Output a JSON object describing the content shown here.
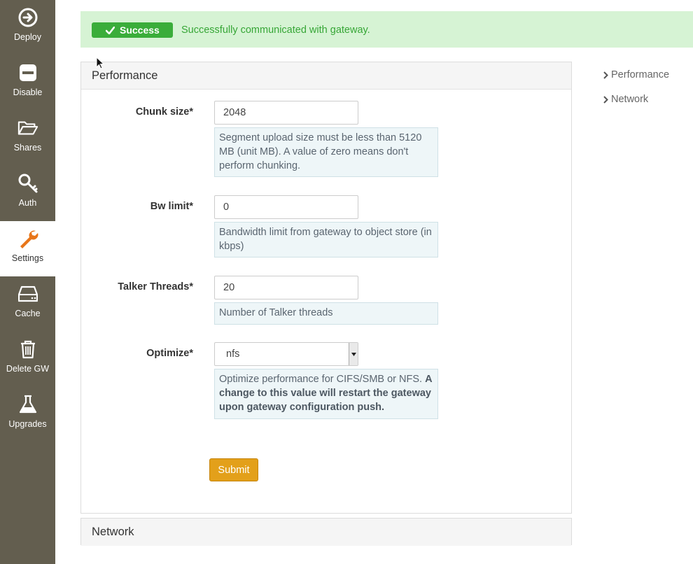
{
  "sidebar": {
    "items": [
      {
        "label": "Deploy",
        "icon": "arrow-circle-right-icon"
      },
      {
        "label": "Disable",
        "icon": "minus-square-icon"
      },
      {
        "label": "Shares",
        "icon": "folder-open-icon"
      },
      {
        "label": "Auth",
        "icon": "key-icon"
      },
      {
        "label": "Settings",
        "icon": "wrench-icon",
        "active": true
      },
      {
        "label": "Cache",
        "icon": "hard-drive-icon"
      },
      {
        "label": "Delete GW",
        "icon": "trash-icon"
      },
      {
        "label": "Upgrades",
        "icon": "flask-icon"
      }
    ]
  },
  "alert": {
    "badge": "Success",
    "message": "Successfully communicated with gateway."
  },
  "performance": {
    "title": "Performance",
    "chunk_size": {
      "label": "Chunk size*",
      "value": "2048",
      "help": "Segment upload size must be less than 5120 MB (unit MB). A value of zero means don't perform chunking."
    },
    "bw_limit": {
      "label": "Bw limit*",
      "value": "0",
      "help": "Bandwidth limit from gateway to object store (in kbps)"
    },
    "talker_threads": {
      "label": "Talker Threads*",
      "value": "20",
      "help": "Number of Talker threads"
    },
    "optimize": {
      "label": "Optimize*",
      "value": "nfs",
      "help_plain": "Optimize performance for CIFS/SMB or NFS.",
      "help_bold": "A change to this value will restart the gateway upon gateway configuration push."
    },
    "submit_label": "Submit"
  },
  "network": {
    "title": "Network"
  },
  "toc": {
    "items": [
      "Performance",
      "Network"
    ]
  },
  "colors": {
    "sidebar_bg": "#635e4f",
    "success_bg": "#d6f3d4",
    "success_badge": "#3aad3a",
    "submit_bg": "#e3a01a"
  }
}
